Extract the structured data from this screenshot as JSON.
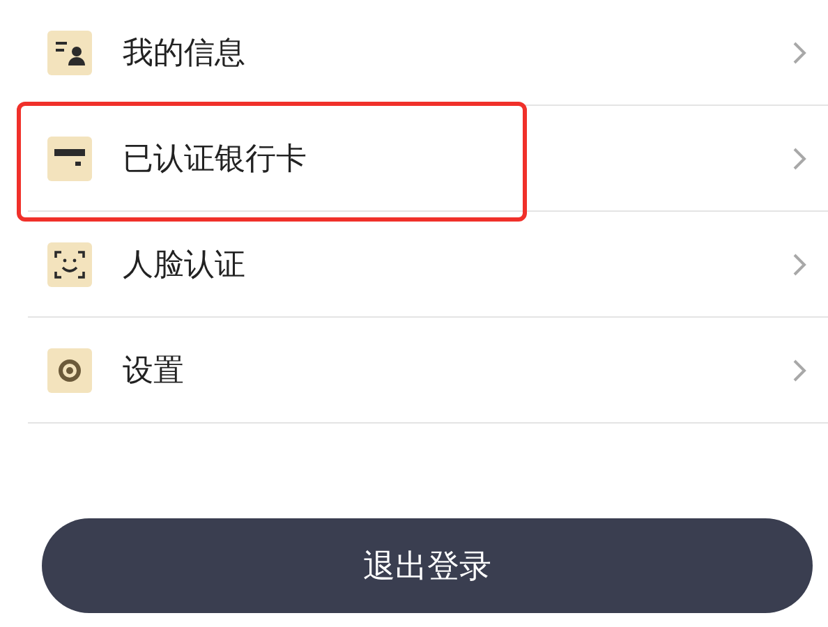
{
  "menu": [
    {
      "kind": "profile",
      "label": "我的信息",
      "highlighted": false
    },
    {
      "kind": "card",
      "label": "已认证银行卡",
      "highlighted": true
    },
    {
      "kind": "face",
      "label": "人脸认证",
      "highlighted": false
    },
    {
      "kind": "settings",
      "label": "设置",
      "highlighted": false
    }
  ],
  "logout_button": "退出登录"
}
